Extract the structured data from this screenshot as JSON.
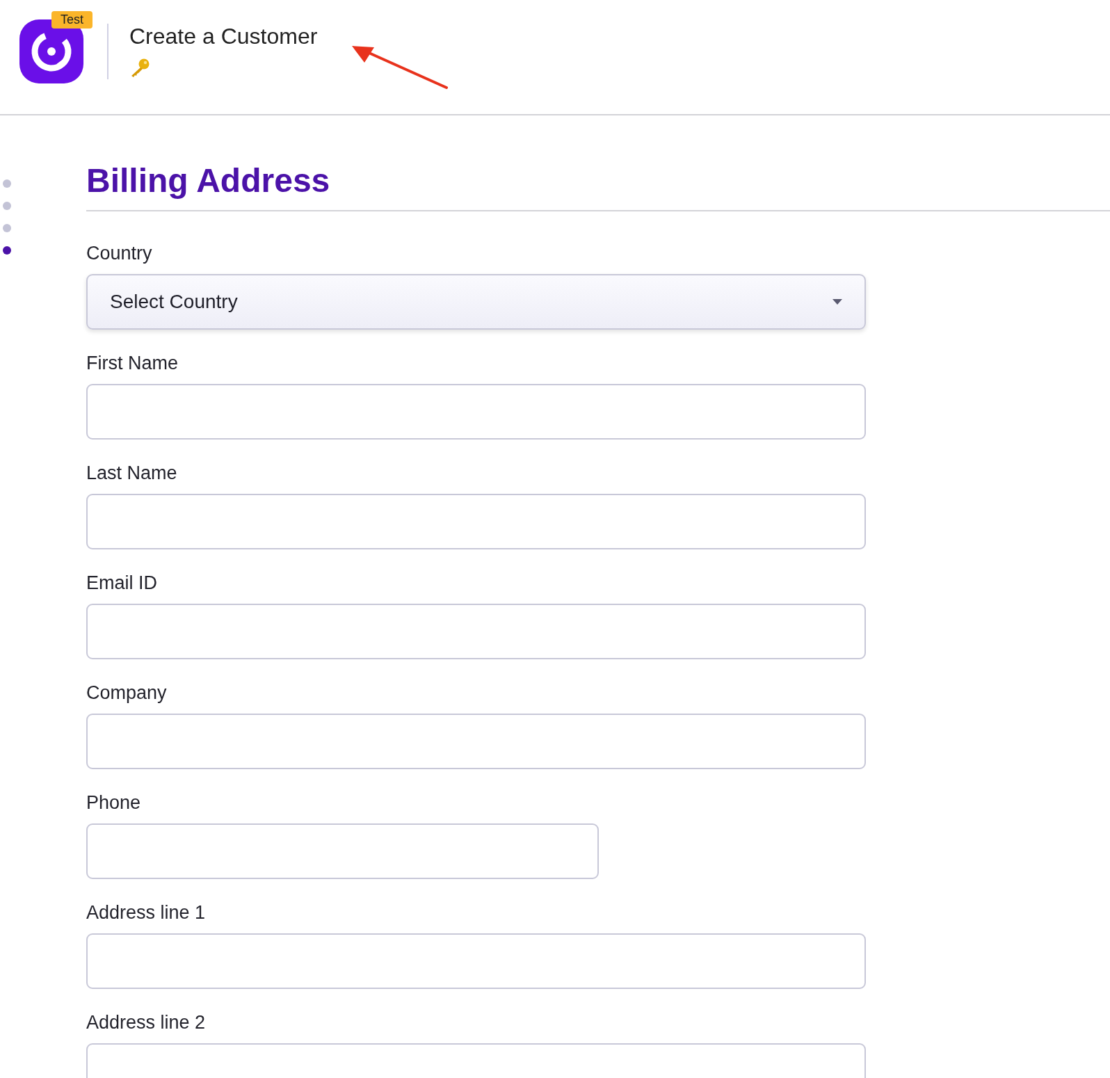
{
  "header": {
    "badge": "Test",
    "title": "Create a Customer"
  },
  "steps": [
    {
      "selected": false
    },
    {
      "selected": false
    },
    {
      "selected": false
    },
    {
      "selected": true
    }
  ],
  "section": {
    "title": "Billing Address"
  },
  "fields": [
    {
      "label": "Country",
      "kind": "select",
      "placeholder": "Select Country"
    },
    {
      "label": "First Name",
      "kind": "text"
    },
    {
      "label": "Last Name",
      "kind": "text"
    },
    {
      "label": "Email ID",
      "kind": "text"
    },
    {
      "label": "Company",
      "kind": "text"
    },
    {
      "label": "Phone",
      "kind": "phone"
    },
    {
      "label": "Address line 1",
      "kind": "text"
    },
    {
      "label": "Address line 2",
      "kind": "text"
    }
  ]
}
